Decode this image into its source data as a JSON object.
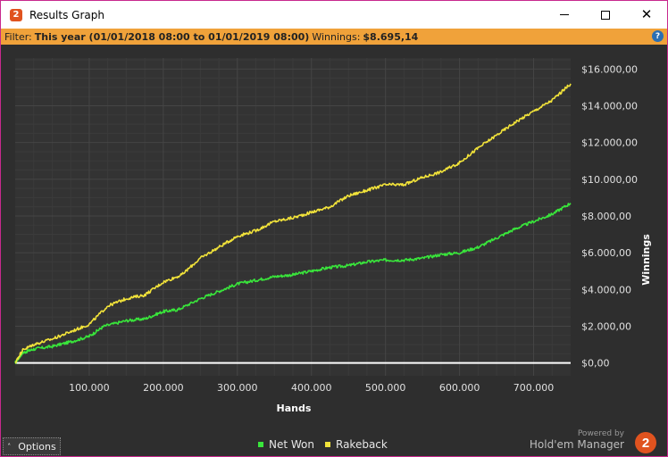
{
  "window": {
    "title": "Results Graph",
    "app_icon_text": "2",
    "minimize_icon": "minimize-icon",
    "maximize_icon": "maximize-icon",
    "close_icon": "close-icon",
    "close_glyph": "✕"
  },
  "filter": {
    "prefix": "Filter:",
    "range": "This year (01/01/2018 08:00 to 01/01/2019 08:00)",
    "winnings_label": "Winnings:",
    "winnings_value": "$8.695,14",
    "help_text": "?"
  },
  "options": {
    "label": "Options",
    "caret": "˄"
  },
  "legend": [
    {
      "label": "Net Won",
      "color": "#39e63b"
    },
    {
      "label": "Rakeback",
      "color": "#f2e33a"
    }
  ],
  "branding": {
    "powered_by": "Powered by",
    "name": "Hold'em Manager",
    "logo_text": "2",
    "logo_color": "#e0531f"
  },
  "colors": {
    "accent_filter": "#f0a23a",
    "background": "#2e2e2e",
    "grid": "#454545",
    "zero_line": "#ffffff"
  },
  "chart_data": {
    "type": "line",
    "xlabel": "Hands",
    "ylabel": "Winnings",
    "xlim": [
      0,
      750000
    ],
    "ylim": [
      -700,
      16600
    ],
    "x_ticks": [
      100000,
      200000,
      300000,
      400000,
      500000,
      600000,
      700000
    ],
    "x_tick_labels": [
      "100.000",
      "200.000",
      "300.000",
      "400.000",
      "500.000",
      "600.000",
      "700.000"
    ],
    "y_ticks": [
      0,
      2000,
      4000,
      6000,
      8000,
      10000,
      12000,
      14000,
      16000
    ],
    "y_tick_labels": [
      "$0,00",
      "$2.000,00",
      "$4.000,00",
      "$6.000,00",
      "$8.000,00",
      "$10.000,00",
      "$12.000,00",
      "$14.000,00",
      "$16.000,00"
    ],
    "grid": true,
    "legend_position": "bottom",
    "series": [
      {
        "name": "Net Won",
        "color": "#39e63b",
        "points": [
          [
            0,
            0
          ],
          [
            10000,
            550
          ],
          [
            25000,
            750
          ],
          [
            50000,
            900
          ],
          [
            75000,
            1150
          ],
          [
            100000,
            1450
          ],
          [
            120000,
            2000
          ],
          [
            150000,
            2300
          ],
          [
            175000,
            2400
          ],
          [
            200000,
            2800
          ],
          [
            220000,
            2900
          ],
          [
            250000,
            3500
          ],
          [
            275000,
            3900
          ],
          [
            300000,
            4300
          ],
          [
            325000,
            4500
          ],
          [
            350000,
            4700
          ],
          [
            375000,
            4800
          ],
          [
            400000,
            5000
          ],
          [
            425000,
            5200
          ],
          [
            450000,
            5300
          ],
          [
            475000,
            5500
          ],
          [
            500000,
            5600
          ],
          [
            525000,
            5600
          ],
          [
            550000,
            5700
          ],
          [
            575000,
            5900
          ],
          [
            600000,
            6000
          ],
          [
            625000,
            6300
          ],
          [
            650000,
            6800
          ],
          [
            675000,
            7300
          ],
          [
            700000,
            7700
          ],
          [
            725000,
            8100
          ],
          [
            750000,
            8700
          ]
        ]
      },
      {
        "name": "Rakeback",
        "color": "#f2e33a",
        "points": [
          [
            0,
            0
          ],
          [
            10000,
            700
          ],
          [
            25000,
            1000
          ],
          [
            50000,
            1300
          ],
          [
            75000,
            1700
          ],
          [
            100000,
            2100
          ],
          [
            125000,
            3100
          ],
          [
            150000,
            3500
          ],
          [
            175000,
            3700
          ],
          [
            200000,
            4400
          ],
          [
            225000,
            4800
          ],
          [
            250000,
            5700
          ],
          [
            275000,
            6300
          ],
          [
            300000,
            6900
          ],
          [
            325000,
            7200
          ],
          [
            350000,
            7700
          ],
          [
            375000,
            7900
          ],
          [
            400000,
            8200
          ],
          [
            425000,
            8500
          ],
          [
            450000,
            9100
          ],
          [
            475000,
            9400
          ],
          [
            500000,
            9700
          ],
          [
            525000,
            9700
          ],
          [
            550000,
            10100
          ],
          [
            575000,
            10400
          ],
          [
            600000,
            10900
          ],
          [
            625000,
            11700
          ],
          [
            650000,
            12400
          ],
          [
            675000,
            13100
          ],
          [
            700000,
            13700
          ],
          [
            725000,
            14300
          ],
          [
            750000,
            15200
          ]
        ]
      }
    ]
  }
}
